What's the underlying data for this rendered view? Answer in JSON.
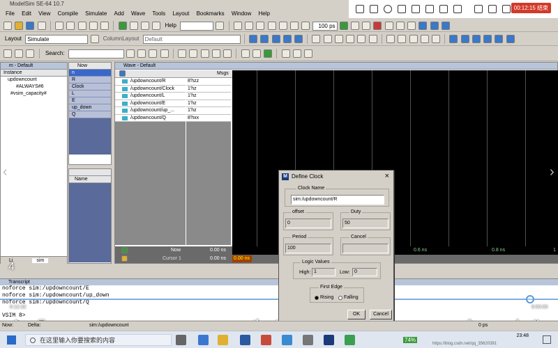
{
  "window": {
    "title": "ModelSim SE-64 10.7"
  },
  "menu": [
    "File",
    "Edit",
    "View",
    "Compile",
    "Simulate",
    "Add",
    "Wave",
    "Tools",
    "Layout",
    "Bookmarks",
    "Window",
    "Help"
  ],
  "recording": {
    "time": "00:12:15 结束"
  },
  "toolbar1": {
    "help_label": "Help",
    "time_value": "100",
    "time_unit": "ps"
  },
  "toolbar2": {
    "layout_label": "Layout",
    "layout_value": "Simulate",
    "column_layout_label": "ColumnLayout",
    "column_layout_value": "Default"
  },
  "toolbar3": {
    "search_label": "Search:"
  },
  "left_pane": {
    "title": "m - Default",
    "column": "Instance",
    "items": [
      "updowncount",
      "#ALWAYS#6",
      "#vsim_capacity#"
    ],
    "tab": "Li",
    "tab2": "sim"
  },
  "objects_pane": {
    "column": "Now",
    "items": [
      "n",
      "R",
      "Clock",
      "L",
      "E",
      "up_down",
      "Q"
    ]
  },
  "process_pane": {
    "column": "Name"
  },
  "wave": {
    "title": "Wave - Default",
    "msgs_label": "Msgs",
    "signals": [
      {
        "name": "/updowncount/R",
        "value": "8'hzz"
      },
      {
        "name": "/updowncount/Clock",
        "value": "1'hz"
      },
      {
        "name": "/updowncount/L",
        "value": "1'hz"
      },
      {
        "name": "/updowncount/E",
        "value": "1'hz"
      },
      {
        "name": "/updowncount/up_...",
        "value": "1'hz"
      },
      {
        "name": "/updowncount/Q",
        "value": "8'hxx"
      }
    ],
    "now_label": "Now",
    "now_value": "0.00 ns",
    "cursor_label": "Cursor 1",
    "cursor_value": "0.00 ns",
    "cursor_marker": "0.00 ns",
    "timeline": [
      "0.6 ns",
      "0.8 ns",
      "1"
    ]
  },
  "transcript": {
    "title": "Transcript",
    "lines": [
      "noforce sim:/updowncount/E",
      "noforce sim:/updowncount/up_down",
      "noforce sim:/updowncount/Q"
    ],
    "prompt": "VSIM 8>"
  },
  "dialog": {
    "title": "Define Clock",
    "clock_name_label": "Clock Name",
    "clock_name_value": "sim:/updowncount/R",
    "offset_label": "offset",
    "offset_value": "0",
    "duty_label": "Duty",
    "duty_value": "50",
    "period_label": "Period",
    "period_value": "100",
    "cancel_group_label": "Cancel",
    "logic_values_label": "Logic Values",
    "high_label": "High:",
    "high_value": "1",
    "low_label": "Low:",
    "low_value": "0",
    "first_edge_label": "First Edge",
    "rising_label": "Rising",
    "falling_label": "Falling",
    "ok_label": "OK",
    "cancel_label": "Cancel"
  },
  "video": {
    "elapsed": "0:12:32",
    "total": "0:00:00",
    "progress": 0.95,
    "left_marker": "4"
  },
  "statusbar": {
    "now_label": "Now:",
    "delta_label": "Delta:",
    "context": "sim:/updowncount",
    "time": "0 ps"
  },
  "taskbar": {
    "search_placeholder": "在这里输入你要搜索的内容",
    "time": "23:48",
    "battery": "74%",
    "url": "https://blog.csdn.net/qq_35620391"
  }
}
